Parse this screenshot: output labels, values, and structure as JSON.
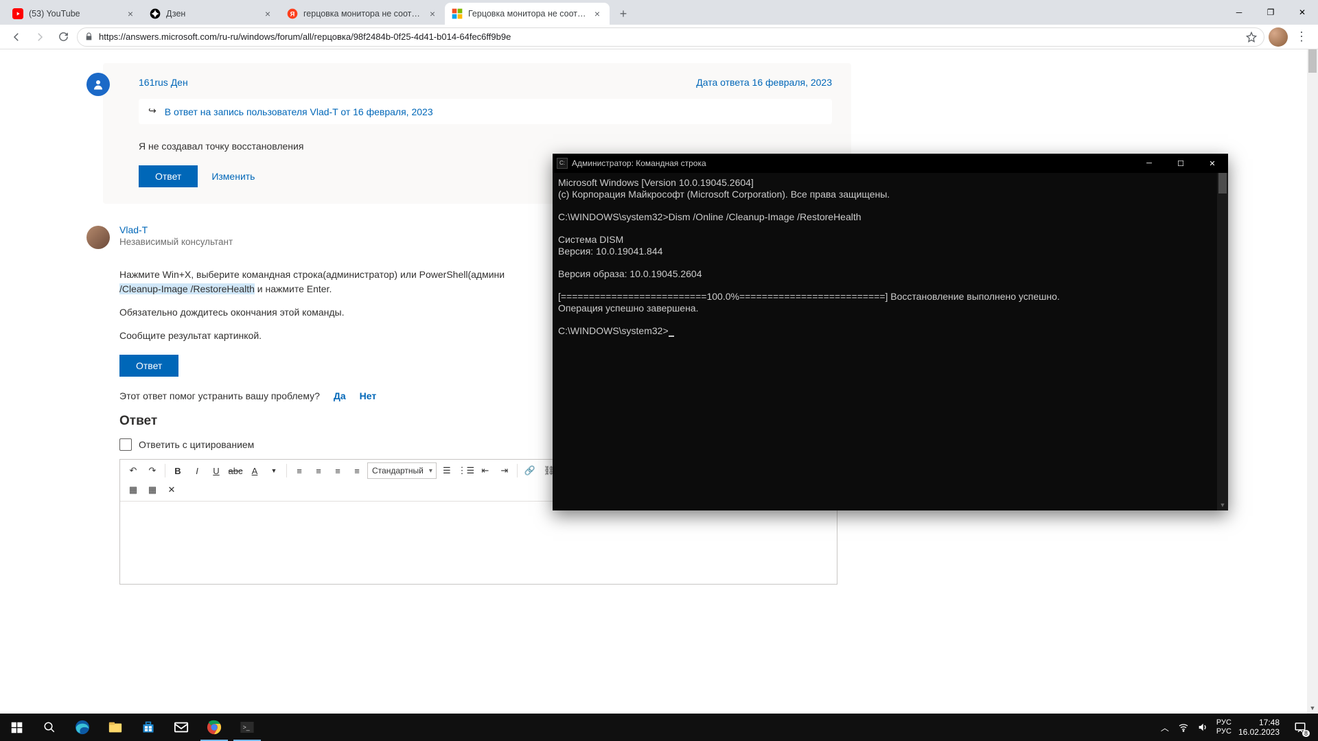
{
  "browser": {
    "tabs": [
      {
        "title": "(53) YouTube",
        "favicon": "youtube"
      },
      {
        "title": "Дзен",
        "favicon": "zen"
      },
      {
        "title": "герцовка монитора не соответ",
        "favicon": "yandex"
      },
      {
        "title": "Герцовка монитора не соответ",
        "favicon": "ms"
      }
    ],
    "active_tab": 3,
    "url": "https://answers.microsoft.com/ru-ru/windows/forum/all/герцовка/98f2484b-0f25-4d41-b014-64fec6ff9b9e"
  },
  "post1": {
    "author": "161rus Ден",
    "date_label": "Дата ответа 16 февраля, 2023",
    "reply_to": "В ответ на запись пользователя Vlad-T от 16 февраля, 2023",
    "body": "Я не создавал точку восстановления",
    "reply_btn": "Ответ",
    "edit_btn": "Изменить"
  },
  "post2": {
    "author": "Vlad-T",
    "role": "Независимый консультант",
    "body_prefix": "Нажмите Win+X, выберите командная строка(администратор) или PowerShell(админи",
    "body_hl": "/Cleanup-Image /RestoreHealth",
    "body_suffix": " и нажмите Enter.",
    "body_p2": "Обязательно дождитесь окончания этой команды.",
    "body_p3": "Сообщите результат картинкой.",
    "reply_btn": "Ответ",
    "helpful_q": "Этот ответ помог устранить вашу проблему?",
    "yes": "Да",
    "no": "Нет"
  },
  "reply_form": {
    "heading": "Ответ",
    "quote_label": "Ответить с цитированием",
    "style": "Стандартный"
  },
  "cmd": {
    "title": "Администратор: Командная строка",
    "line1": "Microsoft Windows [Version 10.0.19045.2604]",
    "line2": "(c) Корпорация Майкрософт (Microsoft Corporation). Все права защищены.",
    "prompt1": "C:\\WINDOWS\\system32>",
    "command1": "Dism /Online /Cleanup-Image /RestoreHealth",
    "line4": "Cистема DISM",
    "line5": "Версия: 10.0.19041.844",
    "line6": "Версия образа: 10.0.19045.2604",
    "progress": "[==========================100.0%==========================] Восстановление выполнено успешно.",
    "line8": "Операция успешно завершена.",
    "prompt2": "C:\\WINDOWS\\system32>"
  },
  "taskbar": {
    "time": "17:48",
    "date": "16.02.2023",
    "lang1": "РУС",
    "lang2": "РУС",
    "notif_count": "8"
  }
}
